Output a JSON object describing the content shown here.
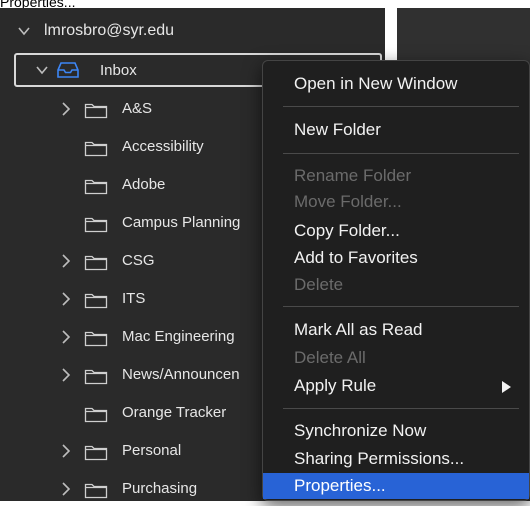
{
  "top_label": "Properties...",
  "account": {
    "label": "lmrosbro@syr.edu"
  },
  "inbox": {
    "label": "Inbox"
  },
  "folders": [
    {
      "label": "A&S",
      "expandable": true
    },
    {
      "label": "Accessibility",
      "expandable": false
    },
    {
      "label": "Adobe",
      "expandable": false
    },
    {
      "label": "Campus Planning",
      "expandable": false
    },
    {
      "label": "CSG",
      "expandable": true
    },
    {
      "label": "ITS",
      "expandable": true
    },
    {
      "label": "Mac Engineering",
      "expandable": true
    },
    {
      "label": "News/Announcen",
      "expandable": true
    },
    {
      "label": "Orange Tracker",
      "expandable": false
    },
    {
      "label": "Personal",
      "expandable": true
    },
    {
      "label": "Purchasing",
      "expandable": true
    }
  ],
  "menu": {
    "open_in_new_window": "Open in New Window",
    "new_folder": "New Folder",
    "rename_folder": "Rename Folder",
    "move_folder": "Move Folder...",
    "copy_folder": "Copy Folder...",
    "add_to_favorites": "Add to Favorites",
    "delete": "Delete",
    "mark_all_as_read": "Mark All as Read",
    "delete_all": "Delete All",
    "apply_rule": "Apply Rule",
    "synchronize_now": "Synchronize Now",
    "sharing_permissions": "Sharing Permissions...",
    "properties": "Properties..."
  },
  "colors": {
    "sidebar_bg": "#2a2a2a",
    "menu_bg": "#1f1f1f",
    "selection": "#2863d6"
  }
}
